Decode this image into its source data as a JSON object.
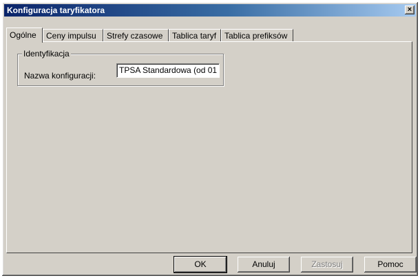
{
  "window": {
    "title": "Konfiguracja taryfikatora",
    "close_label": "×"
  },
  "tabs": [
    {
      "label": "Ogólne",
      "active": true
    },
    {
      "label": "Ceny impulsu",
      "active": false
    },
    {
      "label": "Strefy czasowe",
      "active": false
    },
    {
      "label": "Tablica taryf",
      "active": false
    },
    {
      "label": "Tablica prefiksów",
      "active": false
    }
  ],
  "identification": {
    "group_label": "Identyfikacja",
    "name_label": "Nazwa konfiguracji:",
    "name_value": "TPSA Standardowa (od 01"
  },
  "buttons": {
    "ok": "OK",
    "cancel": "Anuluj",
    "apply": "Zastosuj",
    "help": "Pomoc"
  }
}
